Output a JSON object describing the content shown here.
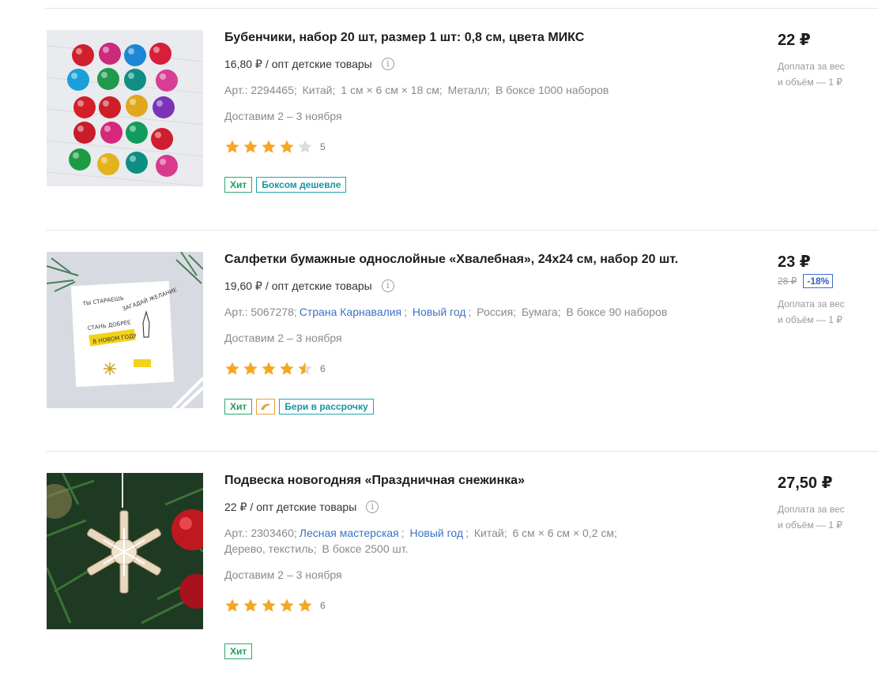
{
  "products": [
    {
      "title": "Бубенчики, набор 20 шт, размер 1 шт: 0,8 см, цвета МИКС",
      "opt_price": "16,80 ₽",
      "opt_sep": "/",
      "opt_label": "опт детские товары",
      "info_icon": "i",
      "attrs": [
        "Арт.: 2294465;",
        "Китай;",
        "1 см × 6 см × 18 см;",
        "Металл;",
        "В боксе 1000 наборов"
      ],
      "delivery": "Доставим 2 – 3 ноября",
      "rating": 4,
      "rating_count": "5",
      "badges": [
        "Хит",
        "Боксом дешевле"
      ],
      "price": "22 ₽",
      "extra_line1": "Доплата за вес",
      "extra_line2": "и объём — 1 ₽"
    },
    {
      "title": "Салфетки бумажные однослойные «Хвалебная», 24х24 см, набор 20 шт.",
      "opt_price": "19,60 ₽",
      "opt_sep": "/",
      "opt_label": "опт детские товары",
      "info_icon": "i",
      "attrs": [
        "Арт.: 5067278;",
        "Страна Карнавалия",
        "Новый год",
        "Россия;",
        "Бумага;",
        "В боксе 90 наборов"
      ],
      "delivery": "Доставим 2 – 3 ноября",
      "rating": 4.5,
      "rating_count": "6",
      "badges": [
        "Хит",
        "Бери в рассрочку"
      ],
      "price": "23 ₽",
      "old_price": "28 ₽",
      "discount": "-18%",
      "extra_line1": "Доплата за вес",
      "extra_line2": "и объём — 1 ₽"
    },
    {
      "title": "Подвеска новогодняя «Праздничная снежинка»",
      "opt_price": "22 ₽",
      "opt_sep": "/",
      "opt_label": "опт детские товары",
      "info_icon": "i",
      "attrs": [
        "Арт.: 2303460;",
        "Лесная мастерская",
        "Новый год",
        "Китай;",
        "6 см × 6 см × 0,2 см;",
        "Дерево, текстиль;",
        "В боксе 2500 шт."
      ],
      "delivery": "Доставим 2 – 3 ноября",
      "rating": 5,
      "rating_count": "6",
      "badges": [
        "Хит"
      ],
      "price": "27,50 ₽",
      "extra_line1": "Доплата за вес",
      "extra_line2": "и объём — 1 ₽"
    }
  ],
  "colors": {
    "star_filled": "#f5a623",
    "star_empty": "#dcdcdc",
    "link": "#3b73c5",
    "badge_green": "#2aaa6a",
    "badge_teal": "#1fa4b0",
    "discount_blue": "#3b6fd0"
  },
  "icons": {
    "installment": "dolphin-icon",
    "info": "info-icon",
    "star": "star-icon"
  }
}
